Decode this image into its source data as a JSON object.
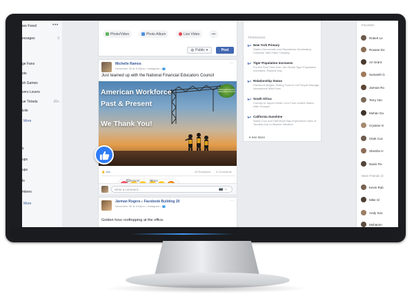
{
  "left_nav": {
    "title": "ws Feed",
    "more": "•••",
    "items": [
      {
        "label": "essages",
        "count": "3"
      },
      {
        "label": "",
        "count": ""
      },
      {
        "label": "ge Fans",
        "count": ""
      },
      {
        "label": "ots",
        "count": ""
      },
      {
        "label": "sh Games",
        "count": ""
      },
      {
        "label": "vers Lovers",
        "count": ""
      },
      {
        "label": "ue Tickets",
        "count": "20+"
      },
      {
        "label": "ivile",
        "count": ""
      }
    ],
    "see_more_1": "More",
    "items_2": [
      "s",
      "ups",
      "ups",
      "ts",
      "mbers"
    ],
    "see_more_2": "More"
  },
  "composer": {
    "photo_video": "Photo/Video",
    "photo_album": "Photo Album",
    "live_video": "Live Video",
    "more": "•••",
    "privacy": "Public",
    "post": "Post"
  },
  "post1": {
    "author": "Michelle Ramos",
    "meta": "November 30 at 6:43pm • Instagram • ",
    "text": "Just teamed up with the National Financial Educators Council",
    "image_line1": "American Workforce",
    "image_line2": "Past & Present",
    "image_line3": "We Thank You!",
    "logo_text": "National Financial Educators Council",
    "likes": "184",
    "reactions": "43 Reactions",
    "comments": "5 Comments",
    "action_comment": "Comment",
    "action_share": "Share",
    "comment_placeholder": "Write a comment..."
  },
  "post2": {
    "author": "Jarman Rogers",
    "feeling": "Facebook Building 20",
    "meta": "November 30 at 6:43pm • Instagram • ",
    "text": "Golden hour rooftopping at the office."
  },
  "trending": {
    "header": "TRENDING",
    "items": [
      {
        "title": "New York Primary",
        "desc": "State's Democratic and Republican Nominating Contests Take Place Tuesday"
      },
      {
        "title": "Tiger Population Increases",
        "desc": "For the First Time Ever, the Global Tiger Population Increases, Reports Say"
      },
      {
        "title": "Relationship Status",
        "desc": "Facebook Begins Testing Tools to Let People Manage Interactions With Exes"
      },
      {
        "title": "South Africa",
        "desc": "Country to Import White Corn From United States After Drought"
      },
      {
        "title": "California Sunshine",
        "desc": "Santa Cruz and Half Moon Bay Experience Influx of Tourists Due to Warmer Weather"
      }
    ],
    "see_more": "See More"
  },
  "chat": {
    "header": "Favorites",
    "contacts": [
      "Robert Le",
      "Roxane Do",
      "Ari Grant",
      "Sumanth G",
      "Jarman Ro",
      "Terry Yan",
      "Mohan Gu",
      "Crystine G",
      "Clark Cox",
      "SheShe H",
      "Davis Fie"
    ],
    "more_friends": "More Friends (2",
    "more_contacts": [
      "Kevin Rub",
      "Mike Sl",
      "Andy Sou",
      "Mohamm"
    ]
  },
  "colors": {
    "fb_blue": "#4267b2",
    "link_blue": "#365899",
    "screen_bg": "#e9ebee",
    "like_blue": "#2f7cf6"
  }
}
